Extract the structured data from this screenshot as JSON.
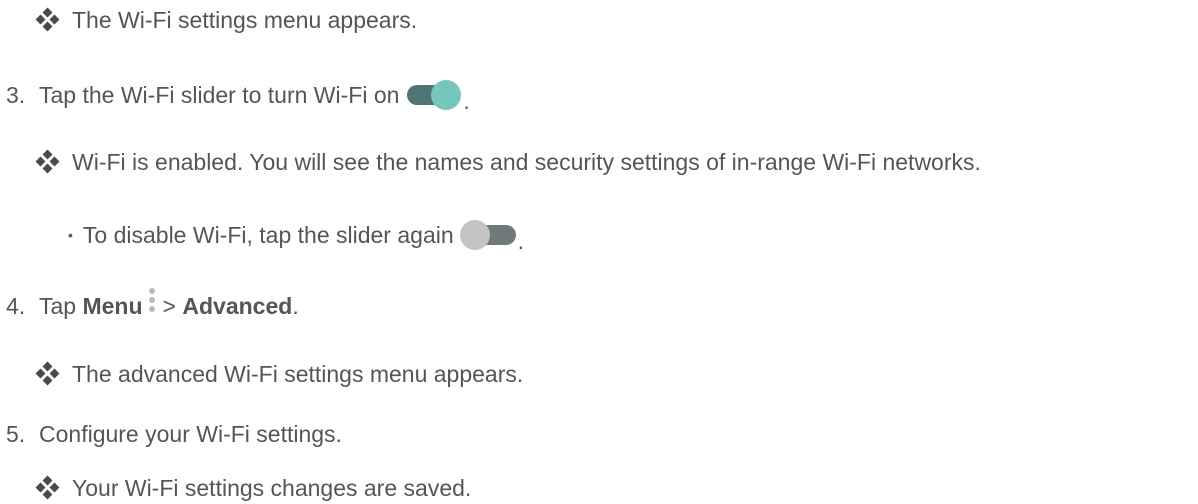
{
  "lines": {
    "r1": "The Wi-Fi settings menu appears.",
    "s3_num": "3.",
    "s3_text": "Tap the Wi-Fi slider to turn Wi-Fi on",
    "s3_period": ".",
    "r2": "Wi-Fi is enabled. You will see the names and security settings of in-range Wi-Fi networks.",
    "b1_text": "To disable Wi-Fi, tap the slider again",
    "b1_period": ".",
    "s4_num": "4.",
    "s4_tap": "Tap",
    "s4_menu": "Menu",
    "s4_gt": ">",
    "s4_advanced": "Advanced",
    "s4_period": ".",
    "r3": "The advanced Wi-Fi settings menu appears.",
    "s5_num": "5.",
    "s5_text": "Configure your Wi-Fi settings.",
    "r4": "Your Wi-Fi settings changes are saved."
  },
  "bullet_glyph": "•",
  "icons": [
    "result-diamonds-icon",
    "toggle-on-icon",
    "toggle-off-icon",
    "menu-kebab-icon"
  ],
  "colors": {
    "text": "#555555",
    "toggle_on_knob": "#76c6bc",
    "toggle_on_track": "#4e7573",
    "toggle_off_knob": "#c3c3c3",
    "toggle_off_track": "#6d7a7b"
  }
}
